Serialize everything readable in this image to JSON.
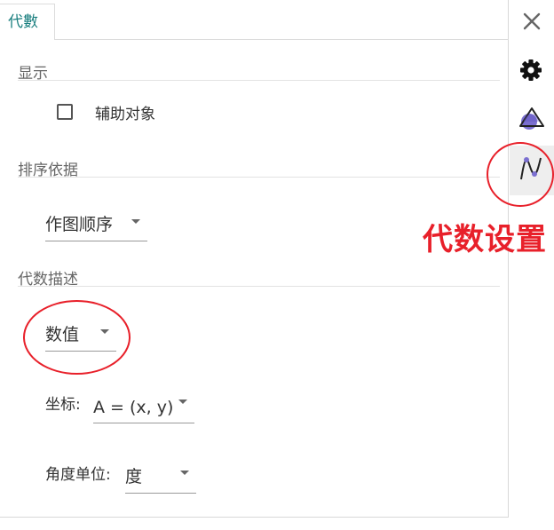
{
  "tab": {
    "label": "代數"
  },
  "sections": {
    "display": {
      "title": "显示",
      "auxiliary_objects_label": "辅助对象"
    },
    "sort": {
      "title": "排序依据",
      "value": "作图顺序"
    },
    "description": {
      "title": "代数描述",
      "value": "数值"
    },
    "coordinates": {
      "label": "坐标:",
      "value": "A = (x, y)"
    },
    "angle_unit": {
      "label": "角度单位:",
      "value": "度"
    }
  },
  "annotation": {
    "text": "代数设置"
  },
  "colors": {
    "accent": "#1a7f7f",
    "annotation": "#e8202a",
    "icon_purple": "#7b6fd0"
  },
  "icons": {
    "close": "close-icon",
    "settings": "gear-icon",
    "graphics": "shapes-icon",
    "algebra": "algebra-curve-icon"
  }
}
